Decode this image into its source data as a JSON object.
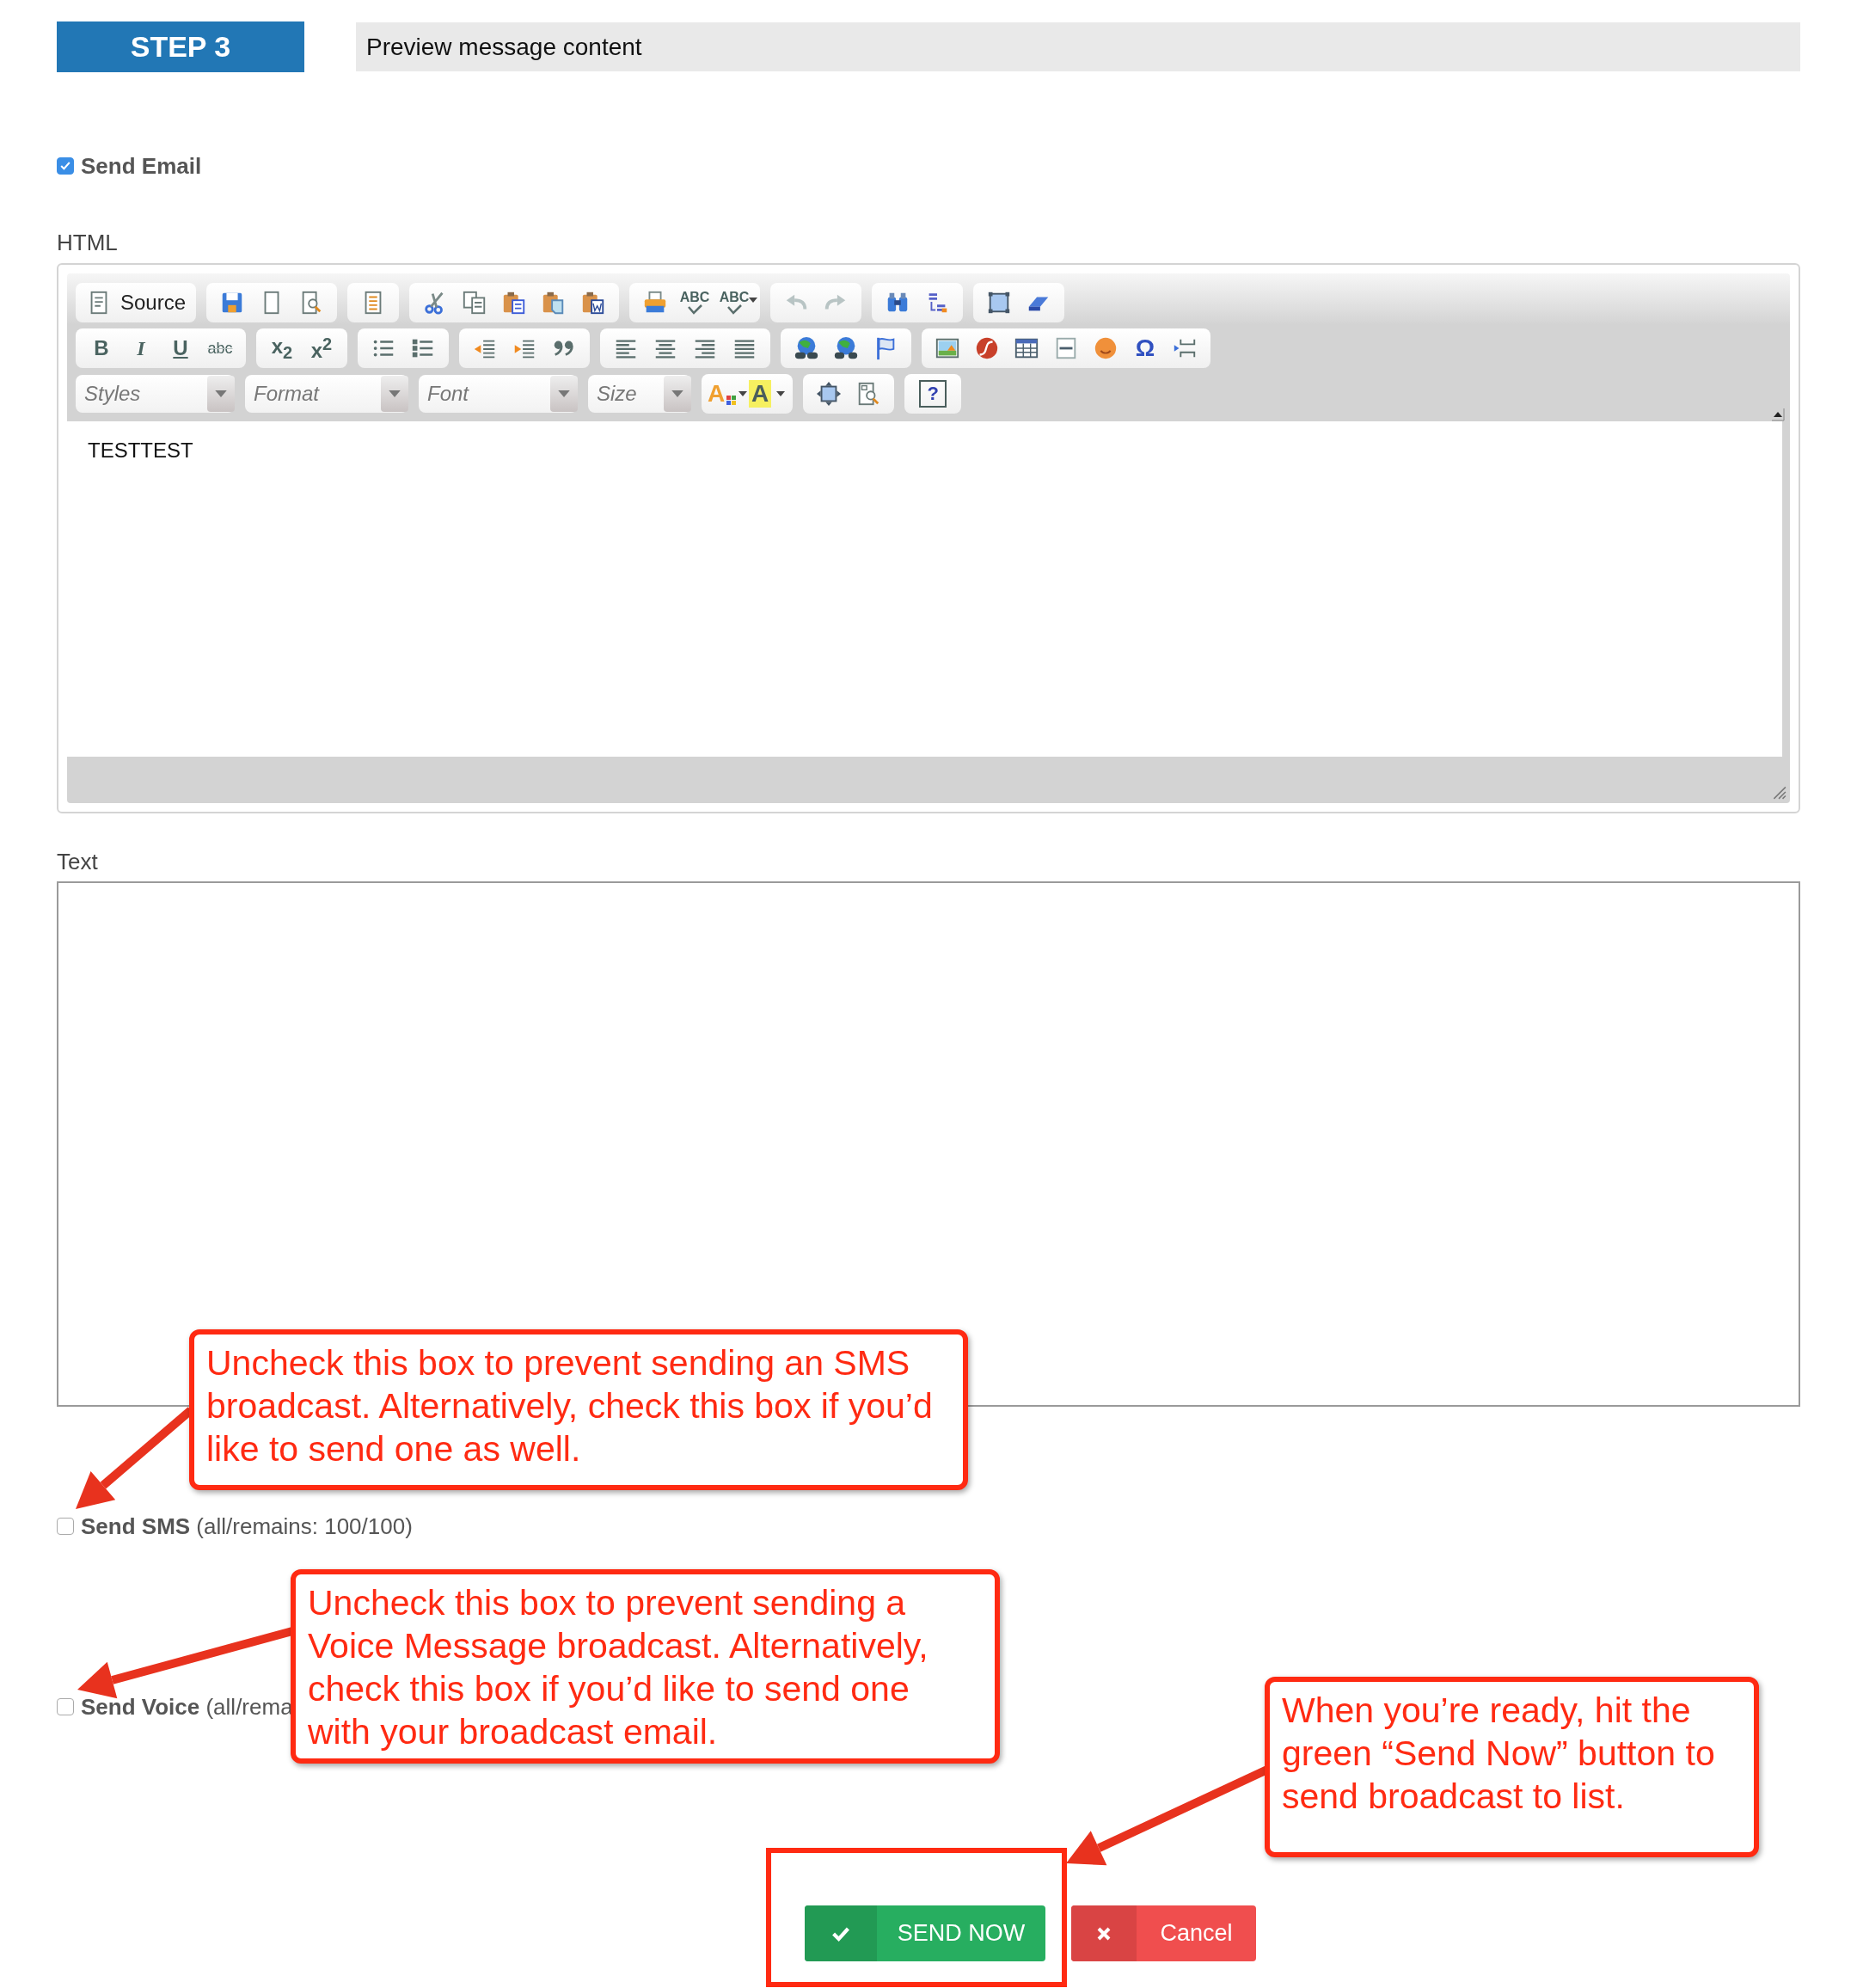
{
  "header": {
    "step": "STEP 3",
    "title": "Preview message content"
  },
  "send_email": {
    "label": "Send Email",
    "checked": true
  },
  "html_label": "HTML",
  "editor": {
    "source": "Source",
    "format_buttons": [
      "B",
      "I",
      "U",
      "abc",
      "x$_{2}$",
      "x$^{2}$"
    ],
    "spellcheck": [
      "ABC",
      "ABC"
    ],
    "special_char": "Ω",
    "colors": [
      "A",
      "A"
    ],
    "help": "?",
    "dropdowns": [
      {
        "label": "Styles"
      },
      {
        "label": "Format"
      },
      {
        "label": "Font"
      },
      {
        "label": "Size"
      }
    ],
    "content": "TESTTEST"
  },
  "text_label": "Text",
  "send_sms": {
    "label": "**Send SMS** (all/remains: 100/100)",
    "checked": false
  },
  "send_voice": {
    "label": "**Send Voice** (all/rema",
    "checked": false
  },
  "actions": [
    {
      "label": "SEND NOW",
      "kind": "primary"
    },
    {
      "label": "Cancel",
      "kind": "danger"
    }
  ],
  "annotations": [
    {
      "text": "Uncheck this box to prevent sending an SMS broadcast. Alternatively, check this box if you’d like to send one as well."
    },
    {
      "text": "Uncheck this box to prevent sending a Voice Message broadcast. Alternatively, check this box if you’d like to send one with your broadcast email."
    },
    {
      "text": "When you’re ready, hit the green “Send Now” button to send broadcast to list."
    }
  ]
}
